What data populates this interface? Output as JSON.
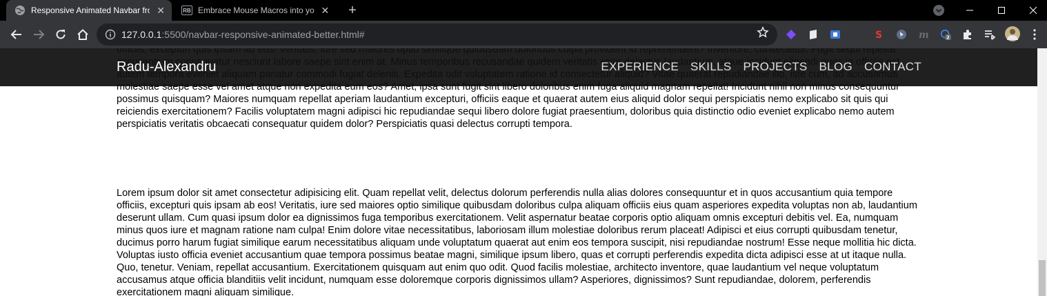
{
  "tabs": [
    {
      "title": "Responsive Animated Navbar fro",
      "favicon": "globe-icon",
      "active": true
    },
    {
      "title": "Embrace Mouse Macros into you",
      "favicon": "rb-icon",
      "favicon_text": "RB",
      "active": false
    }
  ],
  "address_bar": {
    "host": "127.0.0.1",
    "path": ":5500/navbar-responsive-animated-better.html#"
  },
  "extensions": {
    "lastpass_badge": "2"
  },
  "site": {
    "brand": "Radu-Alexandru",
    "nav": [
      "EXPERIENCE",
      "SKILLS",
      "PROJECTS",
      "BLOG",
      "CONTACT"
    ]
  },
  "content": {
    "paragraph_a": "Lorem ipsum dolor sit amet consectetur adipisicing elit. Quam repellat velit, delectus dolorum perferendis nulla alias dolores consequuntur et in quos accusantium quia tempore officiis, excepturi quis ipsam ab eos! Veritatis, iure sed maiores optio similique quibusdam doloribus culpa provident id reprehenderit? Inventore, consectetur. Fugit sequi repellat accusantium consequatur nesciunt labore saepe sint enim at. Minus temporibus recusandae quidem veritatis error delectus laudantium, atque incidunt eligendi quos in officiis est autem tempora eveniet aliquam pariatur commodi fugiat deleniti. Expedita odit voluptatem ratione id consectetur aliquid? Vitae quaerat repudiandae illo, iste cum, ad accusamus molestiae saepe esse vel amet atque non expedita eum eos? Amet, ipsa sunt fugit sint libero doloribus enim fuga aliquid magnam repellat! Incidunt nihil non minus consequuntur possimus quisquam? Maiores numquam repellat aperiam laudantium excepturi, officiis eaque et quaerat autem eius aliquid dolor sequi perspiciatis nemo explicabo sit quis qui reiciendis exercitationem? Facilis voluptatem magni adipisci hic repudiandae sequi libero dolore fugiat praesentium, doloribus quia distinctio odio eveniet explicabo nemo autem perspiciatis veritatis obcaecati consequatur quidem dolor? Perspiciatis quasi delectus corrupti tempora.",
    "paragraph_b": "Lorem ipsum dolor sit amet consectetur adipisicing elit. Quam repellat velit, delectus dolorum perferendis nulla alias dolores consequuntur et in quos accusantium quia tempore officiis, excepturi quis ipsam ab eos! Veritatis, iure sed maiores optio similique quibusdam doloribus culpa aliquam officiis eius quam asperiores expedita voluptas non ab, laudantium deserunt ullam. Cum quasi ipsum dolor ea dignissimos fuga temporibus exercitationem. Velit aspernatur beatae corporis optio aliquam omnis excepturi debitis vel. Ea, numquam minus quos iure et magnam ratione nam culpa! Enim dolore vitae necessitatibus, laboriosam illum molestiae doloribus rerum placeat! Adipisci et eius corrupti quibusdam tenetur, ducimus porro harum fugiat similique earum necessitatibus aliquam unde voluptatum quaerat aut enim eos tempora suscipit, nisi repudiandae nostrum! Esse neque mollitia hic dicta. Voluptas iusto officia eveniet accusantium quae tempora possimus beatae magni, similique ipsum libero, quas et corrupti perferendis expedita dicta adipisci esse at ut itaque nulla. Quo, tenetur. Veniam, repellat accusantium. Exercitationem quisquam aut enim quo odit. Quod facilis molestiae, architecto inventore, quae laudantium vel neque voluptatum accusamus atque officia blanditiis velit incidunt, numquam esse doloremque corporis dignissimos ullam? Asperiores, dignissimos? Sunt repudiandae, dolorem, perferendis exercitationem magni aliquam similique."
  },
  "colors": {
    "chrome_bg": "#000000",
    "toolbar_bg": "#35363a",
    "navbar_bg": "#0f0f0f",
    "page_bg": "#ffffff"
  }
}
